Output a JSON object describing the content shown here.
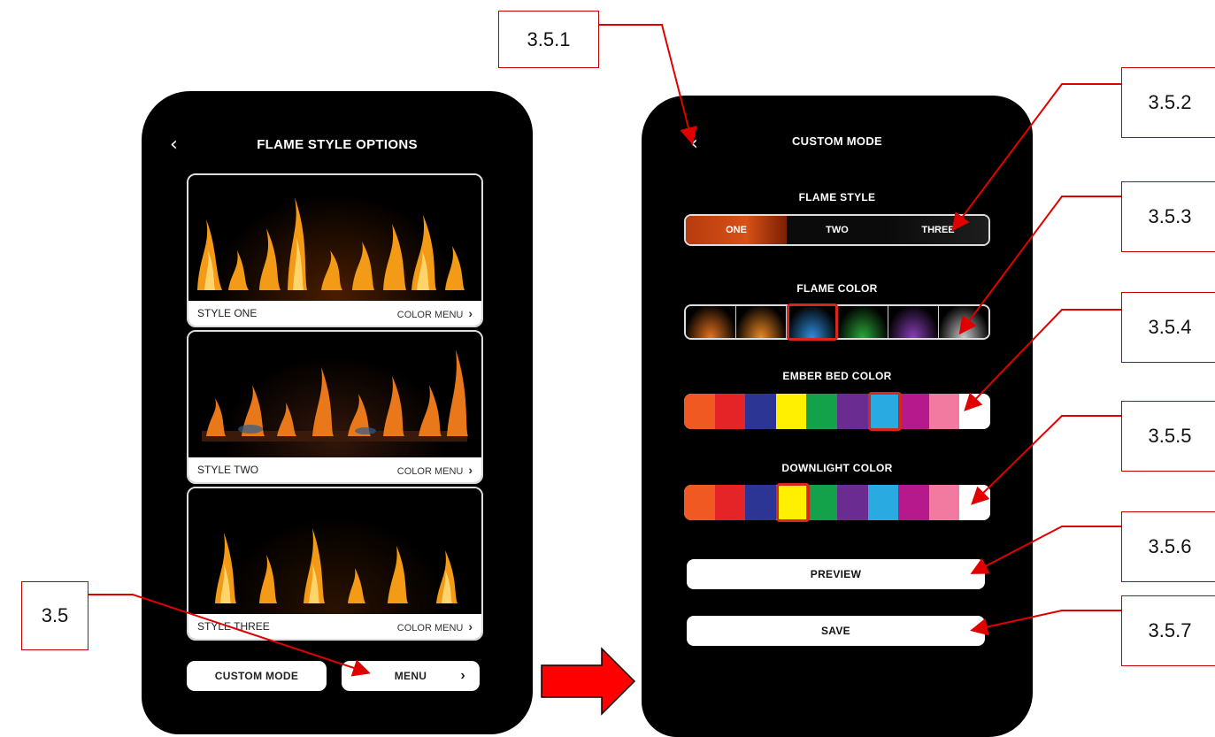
{
  "left_screen": {
    "back_icon": "chevron-left-icon",
    "title": "FLAME STYLE OPTIONS",
    "cards": [
      {
        "label": "STYLE ONE",
        "menu_label": "COLOR MENU"
      },
      {
        "label": "STYLE TWO",
        "menu_label": "COLOR MENU"
      },
      {
        "label": "STYLE THREE",
        "menu_label": "COLOR MENU"
      }
    ],
    "custom_mode_button": "CUSTOM MODE",
    "menu_button": "MENU"
  },
  "right_screen": {
    "back_icon": "chevron-left-icon",
    "title": "CUSTOM MODE",
    "flame_style": {
      "label": "FLAME STYLE",
      "options": [
        "ONE",
        "TWO",
        "THREE"
      ],
      "selected": "ONE"
    },
    "flame_color": {
      "label": "FLAME COLOR",
      "swatches": [
        "#e8741e",
        "#f08a24",
        "#2f8fe0",
        "#2ca83a",
        "#8a3fb8",
        "#c8c8c8"
      ],
      "selected_index": 2
    },
    "ember_bed_color": {
      "label": "EMBER BED COLOR",
      "swatches": [
        "#f05a22",
        "#e52428",
        "#2c3594",
        "#ffef00",
        "#13a24a",
        "#6a2c91",
        "#29aae1",
        "#b5198c",
        "#f27aa1",
        "#ffffff"
      ],
      "selected_index": 6
    },
    "downlight_color": {
      "label": "DOWNLIGHT COLOR",
      "swatches": [
        "#f05a22",
        "#e52428",
        "#2c3594",
        "#ffef00",
        "#13a24a",
        "#6a2c91",
        "#29aae1",
        "#b5198c",
        "#f27aa1",
        "#ffffff"
      ],
      "selected_index": 3
    },
    "preview_button": "PREVIEW",
    "save_button": "SAVE"
  },
  "callouts": [
    "3.5",
    "3.5.1",
    "3.5.2",
    "3.5.3",
    "3.5.4",
    "3.5.5",
    "3.5.6",
    "3.5.7"
  ],
  "colors": {
    "callout_border": "#c00000",
    "arrow": "#e00000",
    "selected_outline": "#d9261c"
  }
}
